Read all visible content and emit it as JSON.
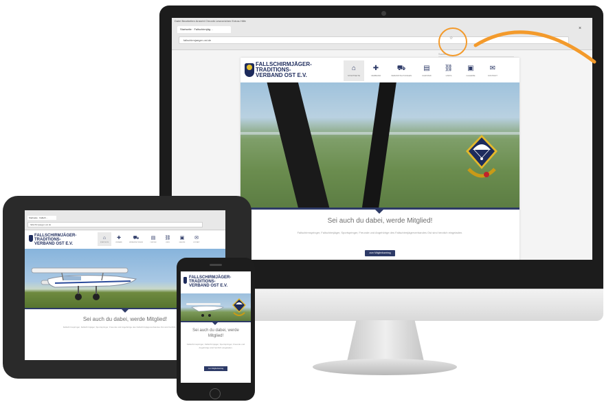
{
  "brand": {
    "name": "FALLSCHIRMJÄGER-\nTRADITIONS-\nVERBAND OST E.V.",
    "primary_color": "#2d3a67",
    "accent_color": "#f39a2b"
  },
  "desktop": {
    "browser": {
      "menu_bar": "Datei  Bearbeiten  Ansicht  Chronik  Lesezeichen  Extras  Hilfe",
      "tab_title": "Startseite · Fallschirmjäg…",
      "url": "fallschirmjaeger-ost.de",
      "search_placeholder": "Suchen",
      "close_glyph": "×",
      "star_glyph": "☆"
    },
    "nav": [
      {
        "label": "STARTSEITE",
        "icon": "home-icon",
        "glyph": "⌂"
      },
      {
        "label": "VERBAND",
        "icon": "plus-icon",
        "glyph": "✚"
      },
      {
        "label": "VERANSTALTUNGEN",
        "icon": "tank-icon",
        "glyph": "⛟"
      },
      {
        "label": "CHRONIK",
        "icon": "document-icon",
        "glyph": "▤"
      },
      {
        "label": "LINKS",
        "icon": "link-icon",
        "glyph": "⛓"
      },
      {
        "label": "GALERIE",
        "icon": "gallery-icon",
        "glyph": "▣"
      },
      {
        "label": "KONTAKT",
        "icon": "mail-icon",
        "glyph": "✉"
      }
    ],
    "headline": "Sei auch du dabei, werde Mitglied!",
    "body": "Fallschirmspringer, Fallschirmjäger, Sportspringer, Freunde und Angehörige des Fallschirmjägerverbandes Ost sind herzlich eingeladen.",
    "cta_label": "zum Mitgliedsantrag"
  },
  "tablet": {
    "tab_title": "Startseite · Fallsch…",
    "url": "fallschirmjaeger-ost.de",
    "headline": "Sei auch du dabei, werde Mitglied!",
    "body": "Fallschirmspringer, Fallschirmjäger, Sportspringer, Freunde und Angehörige des Fallschirmjägerverbandes Ost sind herzlich eingeladen."
  },
  "phone": {
    "headline": "Sei auch du dabei, werde Mitglied!",
    "body": "Fallschirmspringer, Fallschirmjäger, Sportspringer, Freunde und Angehörige sind herzlich eingeladen.",
    "cta_label": "zum Mitgliedsantrag"
  }
}
